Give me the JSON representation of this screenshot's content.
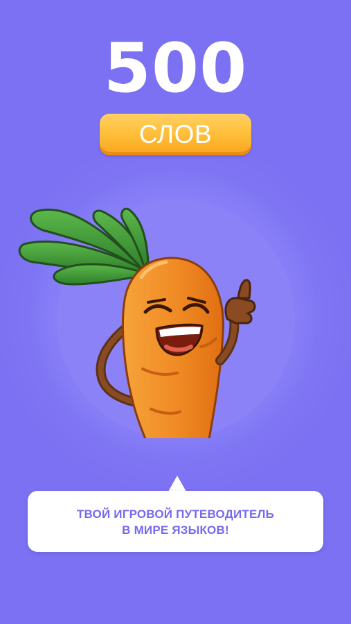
{
  "hero": {
    "count": "500",
    "badge_label": "СЛОВ"
  },
  "mascot": {
    "icon": "carrot-mascot-thumbs-up"
  },
  "speech_bubble": {
    "line1": "ТВОЙ ИГРОВОЙ ПУТЕВОДИТЕЛЬ",
    "line2": "В МИРЕ ЯЗЫКОВ!"
  },
  "colors": {
    "background": "#7b71f2",
    "circle": "#8b82f8",
    "badge": "#ffbd38",
    "bubble_text": "#7569ee",
    "carrot": "#f08a24",
    "leaves": "#3f9a36"
  }
}
